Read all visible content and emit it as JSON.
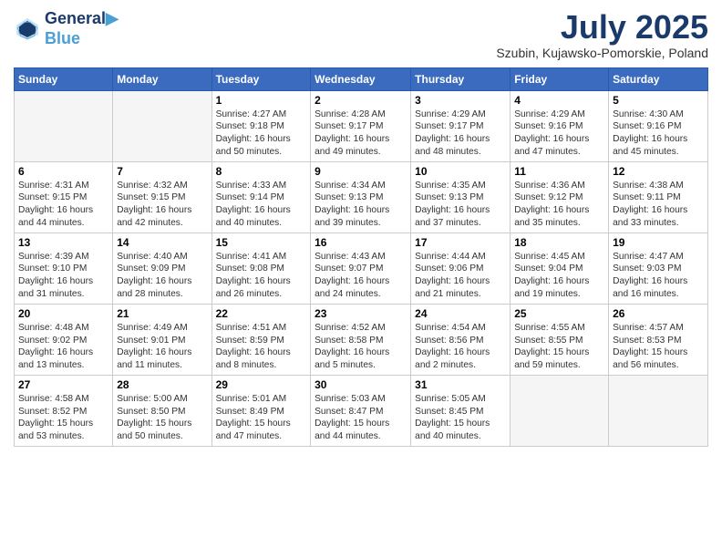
{
  "logo": {
    "line1": "General",
    "line2": "Blue"
  },
  "title": "July 2025",
  "subtitle": "Szubin, Kujawsko-Pomorskie, Poland",
  "days_of_week": [
    "Sunday",
    "Monday",
    "Tuesday",
    "Wednesday",
    "Thursday",
    "Friday",
    "Saturday"
  ],
  "weeks": [
    [
      {
        "day": "",
        "detail": ""
      },
      {
        "day": "",
        "detail": ""
      },
      {
        "day": "1",
        "detail": "Sunrise: 4:27 AM\nSunset: 9:18 PM\nDaylight: 16 hours and 50 minutes."
      },
      {
        "day": "2",
        "detail": "Sunrise: 4:28 AM\nSunset: 9:17 PM\nDaylight: 16 hours and 49 minutes."
      },
      {
        "day": "3",
        "detail": "Sunrise: 4:29 AM\nSunset: 9:17 PM\nDaylight: 16 hours and 48 minutes."
      },
      {
        "day": "4",
        "detail": "Sunrise: 4:29 AM\nSunset: 9:16 PM\nDaylight: 16 hours and 47 minutes."
      },
      {
        "day": "5",
        "detail": "Sunrise: 4:30 AM\nSunset: 9:16 PM\nDaylight: 16 hours and 45 minutes."
      }
    ],
    [
      {
        "day": "6",
        "detail": "Sunrise: 4:31 AM\nSunset: 9:15 PM\nDaylight: 16 hours and 44 minutes."
      },
      {
        "day": "7",
        "detail": "Sunrise: 4:32 AM\nSunset: 9:15 PM\nDaylight: 16 hours and 42 minutes."
      },
      {
        "day": "8",
        "detail": "Sunrise: 4:33 AM\nSunset: 9:14 PM\nDaylight: 16 hours and 40 minutes."
      },
      {
        "day": "9",
        "detail": "Sunrise: 4:34 AM\nSunset: 9:13 PM\nDaylight: 16 hours and 39 minutes."
      },
      {
        "day": "10",
        "detail": "Sunrise: 4:35 AM\nSunset: 9:13 PM\nDaylight: 16 hours and 37 minutes."
      },
      {
        "day": "11",
        "detail": "Sunrise: 4:36 AM\nSunset: 9:12 PM\nDaylight: 16 hours and 35 minutes."
      },
      {
        "day": "12",
        "detail": "Sunrise: 4:38 AM\nSunset: 9:11 PM\nDaylight: 16 hours and 33 minutes."
      }
    ],
    [
      {
        "day": "13",
        "detail": "Sunrise: 4:39 AM\nSunset: 9:10 PM\nDaylight: 16 hours and 31 minutes."
      },
      {
        "day": "14",
        "detail": "Sunrise: 4:40 AM\nSunset: 9:09 PM\nDaylight: 16 hours and 28 minutes."
      },
      {
        "day": "15",
        "detail": "Sunrise: 4:41 AM\nSunset: 9:08 PM\nDaylight: 16 hours and 26 minutes."
      },
      {
        "day": "16",
        "detail": "Sunrise: 4:43 AM\nSunset: 9:07 PM\nDaylight: 16 hours and 24 minutes."
      },
      {
        "day": "17",
        "detail": "Sunrise: 4:44 AM\nSunset: 9:06 PM\nDaylight: 16 hours and 21 minutes."
      },
      {
        "day": "18",
        "detail": "Sunrise: 4:45 AM\nSunset: 9:04 PM\nDaylight: 16 hours and 19 minutes."
      },
      {
        "day": "19",
        "detail": "Sunrise: 4:47 AM\nSunset: 9:03 PM\nDaylight: 16 hours and 16 minutes."
      }
    ],
    [
      {
        "day": "20",
        "detail": "Sunrise: 4:48 AM\nSunset: 9:02 PM\nDaylight: 16 hours and 13 minutes."
      },
      {
        "day": "21",
        "detail": "Sunrise: 4:49 AM\nSunset: 9:01 PM\nDaylight: 16 hours and 11 minutes."
      },
      {
        "day": "22",
        "detail": "Sunrise: 4:51 AM\nSunset: 8:59 PM\nDaylight: 16 hours and 8 minutes."
      },
      {
        "day": "23",
        "detail": "Sunrise: 4:52 AM\nSunset: 8:58 PM\nDaylight: 16 hours and 5 minutes."
      },
      {
        "day": "24",
        "detail": "Sunrise: 4:54 AM\nSunset: 8:56 PM\nDaylight: 16 hours and 2 minutes."
      },
      {
        "day": "25",
        "detail": "Sunrise: 4:55 AM\nSunset: 8:55 PM\nDaylight: 15 hours and 59 minutes."
      },
      {
        "day": "26",
        "detail": "Sunrise: 4:57 AM\nSunset: 8:53 PM\nDaylight: 15 hours and 56 minutes."
      }
    ],
    [
      {
        "day": "27",
        "detail": "Sunrise: 4:58 AM\nSunset: 8:52 PM\nDaylight: 15 hours and 53 minutes."
      },
      {
        "day": "28",
        "detail": "Sunrise: 5:00 AM\nSunset: 8:50 PM\nDaylight: 15 hours and 50 minutes."
      },
      {
        "day": "29",
        "detail": "Sunrise: 5:01 AM\nSunset: 8:49 PM\nDaylight: 15 hours and 47 minutes."
      },
      {
        "day": "30",
        "detail": "Sunrise: 5:03 AM\nSunset: 8:47 PM\nDaylight: 15 hours and 44 minutes."
      },
      {
        "day": "31",
        "detail": "Sunrise: 5:05 AM\nSunset: 8:45 PM\nDaylight: 15 hours and 40 minutes."
      },
      {
        "day": "",
        "detail": ""
      },
      {
        "day": "",
        "detail": ""
      }
    ]
  ]
}
